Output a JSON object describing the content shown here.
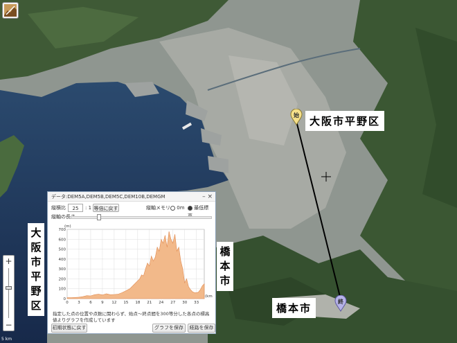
{
  "map": {
    "labels": {
      "start_place": "大阪市平野区",
      "start_place_vertical": "大阪市平野区",
      "end_place": "橋本市",
      "end_place_vertical": "橋本市"
    },
    "pins": {
      "start": "始",
      "end": "終"
    },
    "zoom": {
      "plus": "+",
      "minus": "−"
    },
    "scale_text": "5 km"
  },
  "panel": {
    "title": "データ:DEM5A,DEM5B,DEM5C,DEM10B,DEMGM",
    "window_buttons": "–  ×",
    "vertical_ratio_label": "縦横比",
    "vertical_ratio_value": "25",
    "vertical_ratio_suffix": ": 1",
    "reset_ratio_button": "等倍に戻す",
    "y_axis_mode_label": "縦軸メモリ",
    "y_axis_options": [
      "0m",
      "最低標高"
    ],
    "y_axis_selected": "最低標高",
    "y_length_label": "縦軸の長さ",
    "note": "指定した点の位置や点数に関わらず、始点～終点間を300等分した各点の標高値よりグラフを作成しています",
    "buttons": {
      "reset": "初期状態に戻す",
      "save_graph": "グラフを保存",
      "save_path": "経路を保存"
    }
  },
  "chart_data": {
    "type": "area",
    "ylabel": "(m)",
    "xlabel": "(km)",
    "x_ticks": [
      "0",
      "3",
      "6",
      "9",
      "12",
      "15",
      "18",
      "21",
      "24",
      "27",
      "30",
      "33"
    ],
    "y_ticks": [
      "0",
      "100",
      "200",
      "300",
      "400",
      "500",
      "600",
      "700"
    ],
    "xlim": [
      0,
      35
    ],
    "ylim": [
      0,
      700
    ],
    "series": [
      {
        "color": "#f2b98a",
        "x": [
          0,
          1,
          2,
          3,
          4,
          5,
          6,
          7,
          8,
          9,
          10,
          11,
          12,
          13,
          14,
          15,
          16,
          17,
          18,
          18.5,
          19,
          19.5,
          20,
          20.5,
          21,
          21.5,
          22,
          22.5,
          23,
          23.5,
          24,
          24.5,
          25,
          25.5,
          26,
          26.5,
          27,
          27.5,
          28,
          28.5,
          29,
          29.5,
          30,
          30.5,
          31,
          31.5,
          32,
          32.5,
          33,
          33.5,
          34,
          34.5,
          35
        ],
        "y": [
          10,
          10,
          12,
          15,
          20,
          30,
          28,
          40,
          45,
          38,
          50,
          40,
          42,
          45,
          60,
          80,
          100,
          140,
          180,
          200,
          240,
          230,
          300,
          360,
          330,
          430,
          380,
          420,
          520,
          480,
          600,
          560,
          640,
          520,
          680,
          600,
          560,
          650,
          480,
          520,
          380,
          300,
          160,
          200,
          120,
          90,
          70,
          60,
          60,
          65,
          90,
          130,
          150
        ]
      }
    ]
  }
}
